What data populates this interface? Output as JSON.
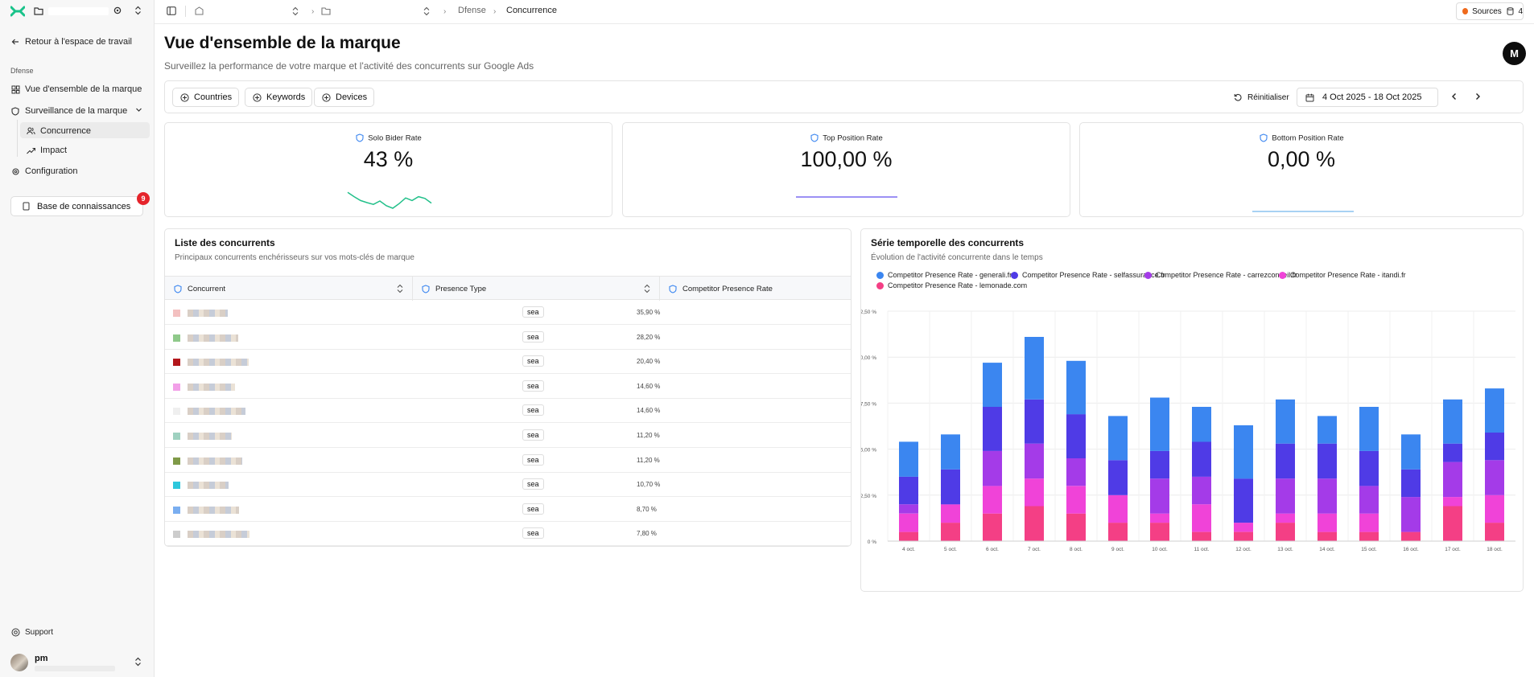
{
  "sidebar": {
    "back_label": "Retour à l'espace de travail",
    "section_label": "Dfense",
    "items": [
      {
        "label": "Vue d'ensemble de la marque"
      },
      {
        "label": "Surveillance de la marque"
      },
      {
        "label": "Concurrence"
      },
      {
        "label": "Impact"
      },
      {
        "label": "Configuration"
      }
    ],
    "knowledge_base": {
      "label": "Base de connaissances",
      "badge": "9"
    },
    "support_label": "Support",
    "user_name": "pm"
  },
  "topbar": {
    "breadcrumb_1": "Dfense",
    "breadcrumb_2": "Concurrence",
    "sources_label": "Sources",
    "sources_count": "4"
  },
  "header": {
    "title": "Vue d'ensemble de la marque",
    "subtitle": "Surveillez la performance de votre marque et l'activité des concurrents sur Google Ads",
    "avatar_letter": "M"
  },
  "filters": {
    "countries": "Countries",
    "keywords": "Keywords",
    "devices": "Devices",
    "reset": "Réinitialiser",
    "date_range": "4 Oct 2025 - 18 Oct 2025"
  },
  "kpis": [
    {
      "title": "Solo Bider Rate",
      "value": "43 %",
      "color": "#22c08a",
      "spark": [
        0.62,
        0.45,
        0.3,
        0.22,
        0.15,
        0.28,
        0.1,
        0.0,
        0.18,
        0.4,
        0.3,
        0.45,
        0.38,
        0.2
      ]
    },
    {
      "title": "Top Position Rate",
      "value": "100,00 %",
      "color": "#7c6cf0",
      "spark": [
        0.5,
        0.5
      ]
    },
    {
      "title": "Bottom Position Rate",
      "value": "0,00 %",
      "color": "#8cc4ef",
      "spark": [
        0.5,
        0.5
      ]
    }
  ],
  "competitors": {
    "title": "Liste des concurrents",
    "subtitle": "Principaux concurrents enchérisseurs sur vos mots-clés de marque",
    "columns": [
      "Concurrent",
      "Presence Type",
      "Competitor Presence Rate"
    ],
    "rows": [
      {
        "type": "sea",
        "rate": "35,90 %",
        "color": "#f3c0c0"
      },
      {
        "type": "sea",
        "rate": "28,20 %",
        "color": "#8fc98a"
      },
      {
        "type": "sea",
        "rate": "20,40 %",
        "color": "#b3171b"
      },
      {
        "type": "sea",
        "rate": "14,60 %",
        "color": "#f2a0e8"
      },
      {
        "type": "sea",
        "rate": "14,60 %",
        "color": "#efefef"
      },
      {
        "type": "sea",
        "rate": "11,20 %",
        "color": "#9fd1c0"
      },
      {
        "type": "sea",
        "rate": "11,20 %",
        "color": "#7f9a48"
      },
      {
        "type": "sea",
        "rate": "10,70 %",
        "color": "#2ec7dc"
      },
      {
        "type": "sea",
        "rate": "8,70 %",
        "color": "#7aaef0"
      },
      {
        "type": "sea",
        "rate": "7,80 %",
        "color": "#cccccc"
      }
    ]
  },
  "timeseries": {
    "title": "Série temporelle des concurrents",
    "subtitle": "Évolution de l'activité concurrente dans le temps"
  },
  "chart_data": {
    "type": "bar",
    "stacked": true,
    "categories": [
      "4 oct.",
      "5 oct.",
      "6 oct.",
      "7 oct.",
      "8 oct.",
      "9 oct.",
      "10 oct.",
      "11 oct.",
      "12 oct.",
      "13 oct.",
      "14 oct.",
      "15 oct.",
      "16 oct.",
      "17 oct.",
      "18 oct."
    ],
    "ylim": [
      0,
      12.5
    ],
    "yticks": [
      "0 %",
      "2,50 %",
      "5,00 %",
      "7,50 %",
      "10,00 %",
      "12,50 %"
    ],
    "grid": true,
    "legend_position": "top",
    "series": [
      {
        "name": "Competitor Presence Rate - lemonade.com",
        "color": "#f43f85",
        "values": [
          0.5,
          1.0,
          1.5,
          1.9,
          1.5,
          1.0,
          1.0,
          0.5,
          0.5,
          1.0,
          0.5,
          0.5,
          0.5,
          1.9,
          1.0
        ]
      },
      {
        "name": "Competitor Presence Rate - itandi.fr",
        "color": "#f043d8",
        "values": [
          1.0,
          1.0,
          1.5,
          1.5,
          1.5,
          1.5,
          0.5,
          1.5,
          0.5,
          0.5,
          1.0,
          1.0,
          0.0,
          0.5,
          1.5
        ]
      },
      {
        "name": "Competitor Presence Rate - carrezconseil.fr",
        "color": "#a43be8",
        "values": [
          0.5,
          0.0,
          1.9,
          1.9,
          1.5,
          0.0,
          1.9,
          1.5,
          0.0,
          1.9,
          1.9,
          1.5,
          1.9,
          1.9,
          1.9
        ]
      },
      {
        "name": "Competitor Presence Rate - selfassurance.fr",
        "color": "#4f3be6",
        "values": [
          1.5,
          1.9,
          2.4,
          2.4,
          2.4,
          1.9,
          1.5,
          1.9,
          2.4,
          1.9,
          1.9,
          1.9,
          1.5,
          1.0,
          1.5
        ]
      },
      {
        "name": "Competitor Presence Rate - generali.fr",
        "color": "#3b86f0",
        "values": [
          1.9,
          1.9,
          2.4,
          3.4,
          2.9,
          2.4,
          2.9,
          1.9,
          2.9,
          2.4,
          1.5,
          2.4,
          1.9,
          2.4,
          2.4
        ]
      }
    ],
    "legend_order": [
      4,
      3,
      2,
      1,
      0
    ]
  }
}
